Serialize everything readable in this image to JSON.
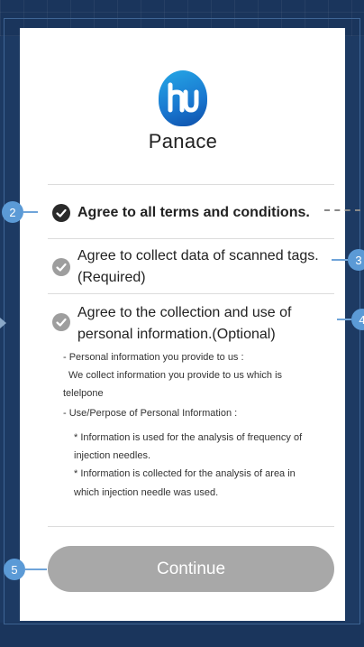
{
  "brand": {
    "name": "Panace",
    "logo_letters": "hu"
  },
  "terms": {
    "all": {
      "label": "Agree to all terms and conditions.",
      "checked": true
    },
    "scanned_tags": {
      "line1": "Agree to collect data of scanned tags.",
      "line2": "(Required)",
      "checked": false
    },
    "personal_info": {
      "line1": "Agree to the collection and use of",
      "line2": "personal information.(Optional)",
      "checked": false,
      "details": [
        "- Personal information you provide to us :",
        "We collect information you provide to us which is",
        "telelpone",
        "- Use/Perpose of Personal Information :",
        "* Information is used for the analysis of frequency of",
        "injection needles.",
        "* Information is collected for the analysis of area in",
        "which injection needle was used."
      ]
    }
  },
  "continue_button": {
    "label": "Continue"
  },
  "callouts": [
    "2",
    "3",
    "4",
    "5"
  ],
  "colors": {
    "background": "#1d3a63",
    "callout": "#5b9ad6",
    "checked": "#2a2a2a",
    "unchecked": "#9e9e9e",
    "button_disabled": "#a8a8a8",
    "logo": "#1976cf"
  }
}
